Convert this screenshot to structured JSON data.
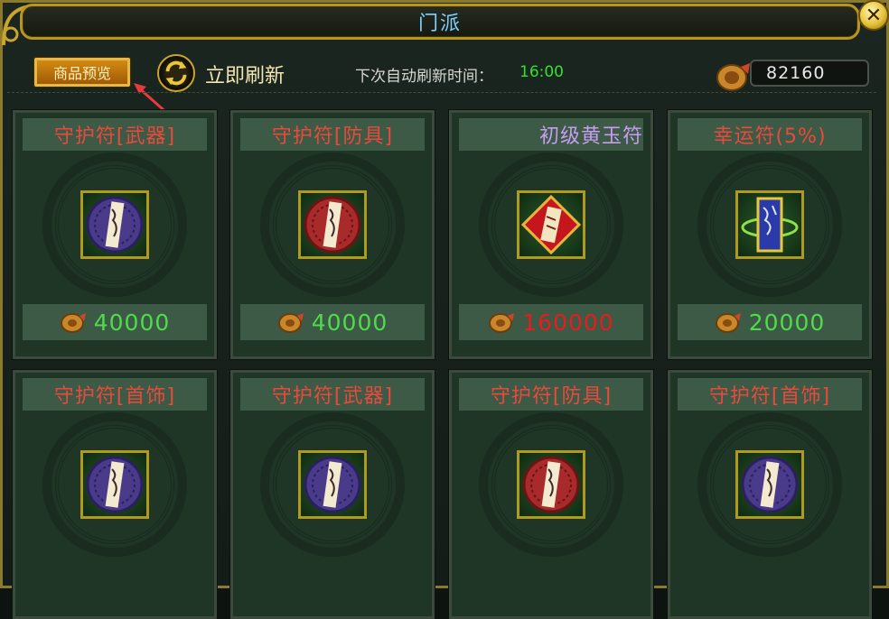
{
  "window": {
    "title": "门派",
    "close_label": "✕"
  },
  "toolbar": {
    "preview_label": "商品预览",
    "refresh_label": "立即刷新",
    "auto_refresh_label": "下次自动刷新时间：",
    "auto_refresh_time": "16:00",
    "currency_amount": "82160"
  },
  "colors": {
    "price_normal": "#4fdc4a",
    "price_expensive": "#e81c1c",
    "item_name_red": "#e84a3c",
    "item_name_purple": "#c89cf2",
    "title": "#7fd0ff"
  },
  "items": [
    {
      "name": "守护符[武器]",
      "icon": "purple-talisman-icon",
      "price": "40000"
    },
    {
      "name": "守护符[防具]",
      "icon": "red-talisman-icon",
      "price": "40000"
    },
    {
      "name": "初级黄玉符",
      "icon": "topaz-talisman-icon",
      "price": "160000"
    },
    {
      "name": "幸运符(5%)",
      "icon": "blue-scroll-icon",
      "price": "20000"
    },
    {
      "name": "守护符[首饰]",
      "icon": "purple-talisman-icon",
      "price": ""
    },
    {
      "name": "守护符[武器]",
      "icon": "purple-talisman-icon",
      "price": ""
    },
    {
      "name": "守护符[防具]",
      "icon": "red-talisman-icon",
      "price": ""
    },
    {
      "name": "守护符[首饰]",
      "icon": "purple-talisman-icon",
      "price": ""
    }
  ]
}
